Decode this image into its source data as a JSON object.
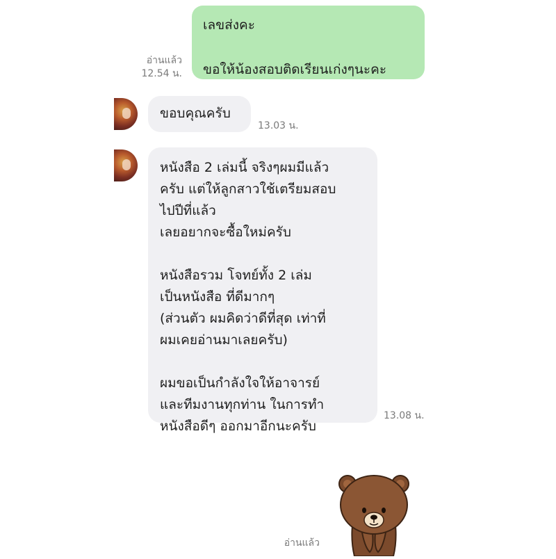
{
  "outgoing": {
    "text": "เลขส่งคะ\n\nขอให้น้องสอบติดเรียนเก่งๆนะคะ",
    "read_label": "อ่านแล้ว",
    "time": "12.54 น."
  },
  "incoming": [
    {
      "text": "ขอบคุณครับ",
      "time": "13.03 น."
    },
    {
      "text": "หนังสือ 2 เล่มนี้ จริงๆผมมีแล้ว\nครับ แต่ให้ลูกสาวใช้เตรียมสอบ\nไปปีที่แล้ว\nเลยอยากจะซื้อใหม่ครับ\n\nหนังสือรวม โจทย์ทั้ง 2 เล่ม\nเป็นหนังสือ ที่ดีมากๆ\n(ส่วนตัว ผมคิดว่าดีที่สุด เท่าที่\nผมเคยอ่านมาเลยครับ)\n\nผมขอเป็นกำลังใจให้อาจารย์\nและทีมงานทุกท่าน ในการทำ\nหนังสือดีๆ ออกมาอีกนะครับ",
      "time": "13.08 น."
    }
  ],
  "sticker": {
    "icon": "brown-bear-sticker",
    "read_label": "อ่านแล้ว"
  }
}
